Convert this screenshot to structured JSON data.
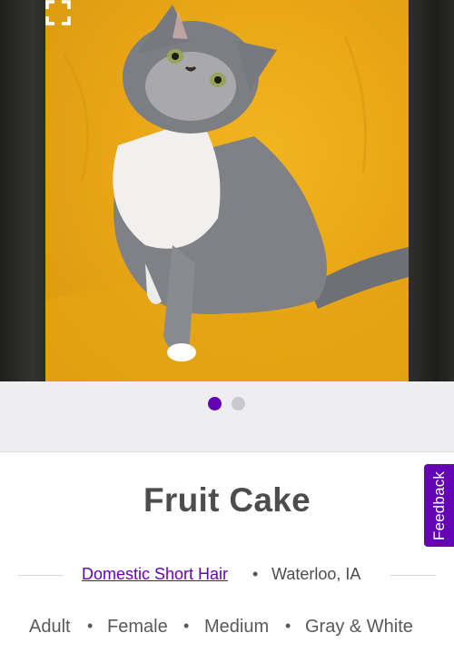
{
  "carousel": {
    "current_slide": 1,
    "total_slides": 2,
    "expand_icon": "fullscreen-expand-icon",
    "dot_active_color": "#6504b5",
    "dot_inactive_color": "#c9c8cf"
  },
  "pet": {
    "name": "Fruit Cake",
    "breed": "Domestic Short Hair",
    "location": "Waterloo, IA",
    "separator": "•",
    "traits": [
      "Adult",
      "Female",
      "Medium",
      "Gray & White"
    ]
  },
  "feedback": {
    "label": "Feedback",
    "color": "#6504b5"
  }
}
